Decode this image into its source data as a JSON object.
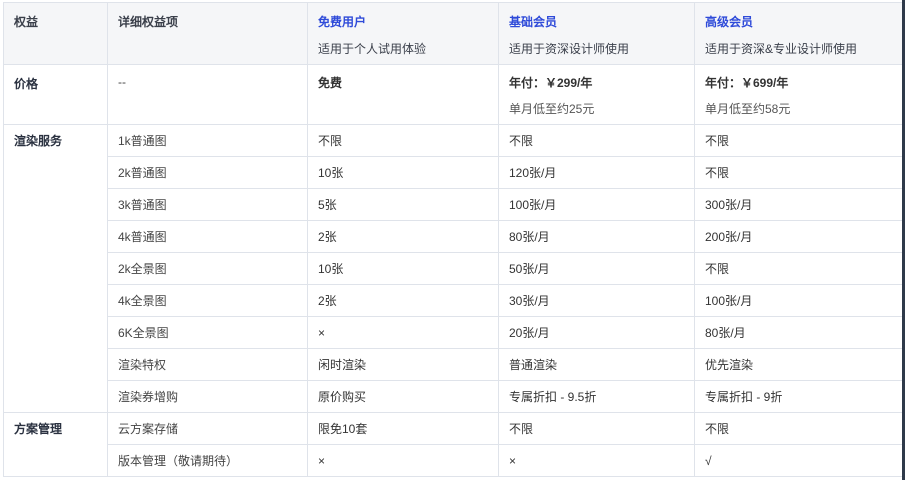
{
  "header": {
    "category_label": "权益",
    "detail_label": "详细权益项",
    "plans": [
      {
        "name": "免费用户",
        "desc": "适用于个人试用体验"
      },
      {
        "name": "基础会员",
        "desc": "适用于资深设计师使用"
      },
      {
        "name": "高级会员",
        "desc": "适用于资深&专业设计师使用"
      }
    ]
  },
  "price": {
    "category": "价格",
    "detail": "--",
    "values": [
      {
        "main": "免费",
        "sub": ""
      },
      {
        "main": "年付：￥299/年",
        "sub": "单月低至约25元"
      },
      {
        "main": "年付：￥699/年",
        "sub": "单月低至约58元"
      }
    ]
  },
  "render_service": {
    "category": "渲染服务",
    "rows": [
      {
        "item": "1k普通图",
        "values": [
          "不限",
          "不限",
          "不限"
        ]
      },
      {
        "item": "2k普通图",
        "values": [
          "10张",
          "120张/月",
          "不限"
        ]
      },
      {
        "item": "3k普通图",
        "values": [
          "5张",
          "100张/月",
          "300张/月"
        ]
      },
      {
        "item": "4k普通图",
        "values": [
          "2张",
          "80张/月",
          "200张/月"
        ]
      },
      {
        "item": "2k全景图",
        "values": [
          "10张",
          "50张/月",
          "不限"
        ]
      },
      {
        "item": "4k全景图",
        "values": [
          "2张",
          "30张/月",
          "100张/月"
        ]
      },
      {
        "item": "6K全景图",
        "values": [
          "×",
          "20张/月",
          "80张/月"
        ]
      },
      {
        "item": "渲染特权",
        "values": [
          "闲时渲染",
          "普通渲染",
          "优先渲染"
        ]
      },
      {
        "item": "渲染券增购",
        "values": [
          "原价购买",
          "专属折扣 - 9.5折",
          "专属折扣 - 9折"
        ]
      }
    ]
  },
  "plan_mgmt": {
    "category": "方案管理",
    "rows": [
      {
        "item": "云方案存储",
        "values": [
          "限免10套",
          "不限",
          "不限"
        ]
      },
      {
        "item": "版本管理（敬请期待）",
        "values": [
          "×",
          "×",
          "√"
        ]
      }
    ]
  }
}
